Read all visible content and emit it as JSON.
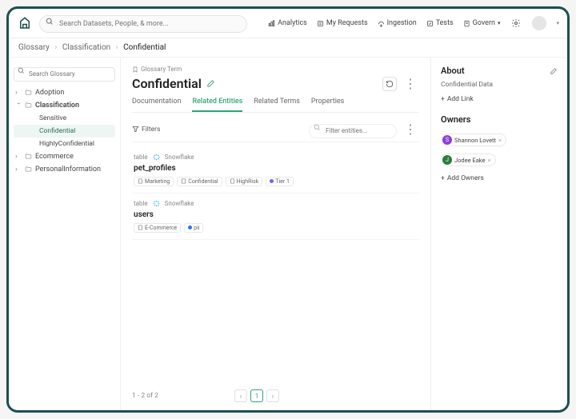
{
  "topbar": {
    "search_placeholder": "Search Datasets, People, & more...",
    "links": {
      "analytics": "Analytics",
      "my_requests": "My Requests",
      "ingestion": "Ingestion",
      "tests": "Tests",
      "govern": "Govern"
    }
  },
  "breadcrumbs": {
    "items": [
      "Glossary",
      "Classification",
      "Confidential"
    ]
  },
  "sidebar": {
    "search_placeholder": "Search Glossary",
    "nodes": {
      "adoption": "Adoption",
      "classification": "Classification",
      "sensitive": "Sensitive",
      "confidential": "Confidential",
      "highly_confidential": "HighlyConfidential",
      "ecommerce": "Ecommerce",
      "personal_info": "PersonalInformation"
    }
  },
  "page": {
    "term_label": "Glossary Term",
    "title": "Confidential",
    "tabs": {
      "documentation": "Documentation",
      "related_entities": "Related Entities",
      "related_terms": "Related Terms",
      "properties": "Properties"
    },
    "filters_label": "Filters",
    "filter_placeholder": "Filter entities...",
    "entities": [
      {
        "type": "table",
        "platform": "Snowflake",
        "name": "pet_profiles",
        "tags": [
          {
            "label": "Marketing",
            "icon": "doc"
          },
          {
            "label": "Confidential",
            "icon": "doc"
          },
          {
            "label": "HighRisk",
            "icon": "doc"
          },
          {
            "label": "Tier 1",
            "icon": "dot",
            "color": "#7a5cff"
          }
        ]
      },
      {
        "type": "table",
        "platform": "Snowflake",
        "name": "users",
        "tags": [
          {
            "label": "E-Commerce",
            "icon": "doc"
          },
          {
            "label": "pii",
            "icon": "dot",
            "color": "#2f6fff"
          }
        ]
      }
    ],
    "pagination": {
      "info": "1 - 2 of 2",
      "current": "1"
    }
  },
  "about": {
    "heading": "About",
    "description": "Confidential Data",
    "add_link": "Add Link",
    "owners_heading": "Owners",
    "owners": [
      {
        "initial": "S",
        "name": "Shannon Lovett",
        "color": "#8b3fd9"
      },
      {
        "initial": "J",
        "name": "Jodee Eake",
        "color": "#2a7d3f"
      }
    ],
    "add_owners": "Add Owners"
  }
}
